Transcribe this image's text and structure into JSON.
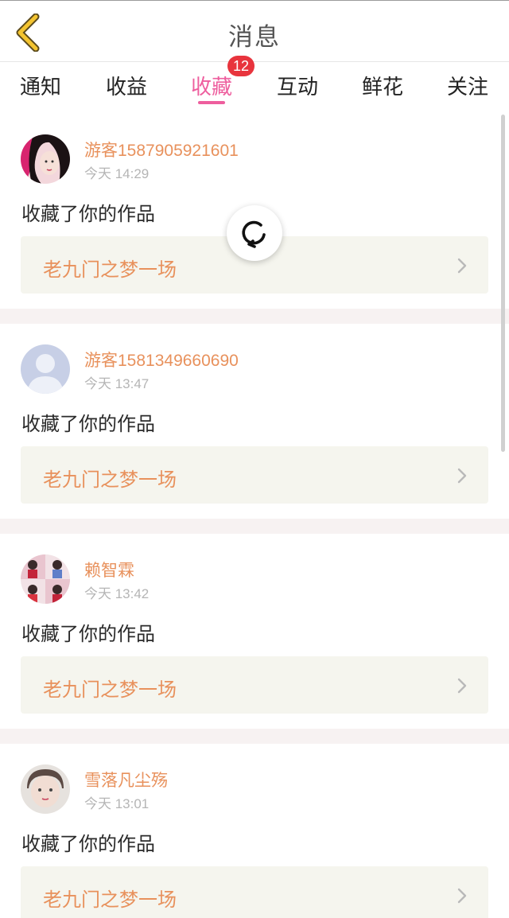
{
  "header": {
    "title": "消息"
  },
  "tabs": [
    {
      "label": "通知"
    },
    {
      "label": "收益"
    },
    {
      "label": "收藏",
      "active": true,
      "badge": "12"
    },
    {
      "label": "互动"
    },
    {
      "label": "鲜花"
    },
    {
      "label": "关注"
    }
  ],
  "colors": {
    "accent": "#ee5e9e",
    "username": "#e8915c",
    "badge": "#e8343d"
  },
  "items": [
    {
      "username": "游客1587905921601",
      "time": "今天 14:29",
      "action": "收藏了你的作品",
      "work": "老九门之梦一场"
    },
    {
      "username": "游客1581349660690",
      "time": "今天 13:47",
      "action": "收藏了你的作品",
      "work": "老九门之梦一场"
    },
    {
      "username": "赖智霖",
      "time": "今天 13:42",
      "action": "收藏了你的作品",
      "work": "老九门之梦一场"
    },
    {
      "username": "雪落凡尘殇",
      "time": "今天 13:01",
      "action": "收藏了你的作品",
      "work": "老九门之梦一场"
    }
  ]
}
